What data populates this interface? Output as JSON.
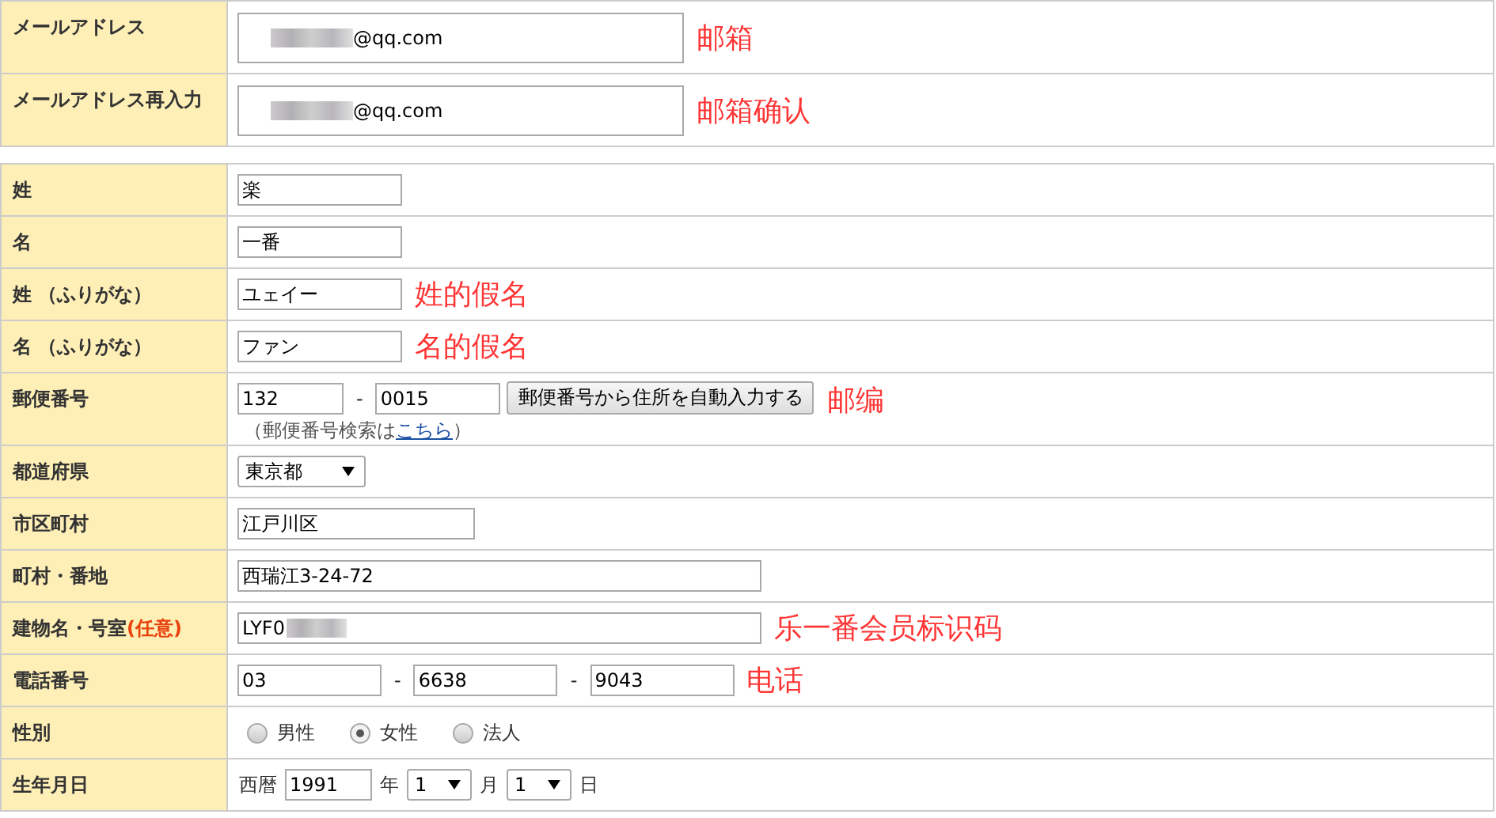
{
  "email_section": {
    "rows": [
      {
        "label": "メールアドレス",
        "value": "@qq.com",
        "redacted": true,
        "annotation": "邮箱"
      },
      {
        "label": "メールアドレス再入力",
        "value": "@qq.com",
        "redacted": true,
        "annotation": "邮箱确认"
      }
    ]
  },
  "form_rows": [
    {
      "kind": "short",
      "label": "姓",
      "value": "楽"
    },
    {
      "kind": "short",
      "label": "名",
      "value": "一番"
    },
    {
      "kind": "short",
      "label": "姓 （ふりがな）",
      "value": "ユェイー",
      "annotation": "姓的假名"
    },
    {
      "kind": "short",
      "label": "名 （ふりがな）",
      "value": "ファン",
      "annotation": "名的假名"
    },
    {
      "kind": "postal",
      "label": "郵便番号",
      "parts": [
        "132",
        "0015"
      ],
      "separators": [
        "-"
      ],
      "button": "郵便番号から住所を自動入力する",
      "note_before": "（郵便番号検索は",
      "link": "こちら",
      "note_after": "）",
      "annotation": "邮编"
    },
    {
      "kind": "select",
      "label": "都道府県",
      "value": "東京都"
    },
    {
      "kind": "medium",
      "label": "市区町村",
      "value": "江戸川区"
    },
    {
      "kind": "long",
      "label": "町村・番地",
      "value": "西瑞江3-24-72"
    },
    {
      "kind": "long",
      "label": "建物名・号室",
      "optional_mark": "(任意)",
      "value": "LYF0",
      "redacted": true,
      "annotation": "乐一番会员标识码"
    },
    {
      "kind": "phone",
      "label": "電話番号",
      "parts": [
        "03",
        "6638",
        "9043"
      ],
      "separators": [
        "-",
        "-"
      ],
      "annotation": "电话"
    },
    {
      "kind": "radio",
      "label": "性別",
      "options": [
        {
          "label": "男性",
          "selected": false
        },
        {
          "label": "女性",
          "selected": true
        },
        {
          "label": "法人",
          "selected": false
        }
      ]
    },
    {
      "kind": "date",
      "label": "生年月日",
      "era": "西暦",
      "year": "1991",
      "year_unit": "年",
      "month": "1",
      "month_unit": "月",
      "day": "1",
      "day_unit": "日"
    }
  ]
}
